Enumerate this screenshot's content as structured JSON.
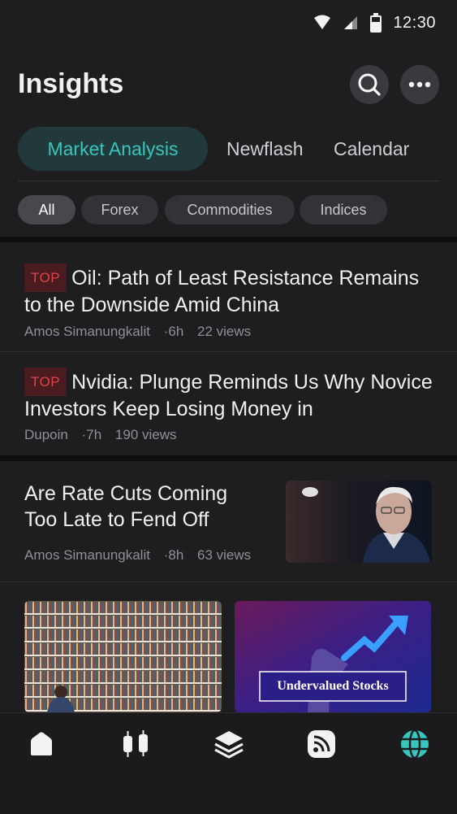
{
  "status_bar": {
    "time": "12:30"
  },
  "header": {
    "title": "Insights"
  },
  "tabs": [
    "Market Analysis",
    "Newflash",
    "Calendar"
  ],
  "filters": [
    "All",
    "Forex",
    "Commodities",
    "Indices"
  ],
  "articles": [
    {
      "tag": "TOP",
      "title": "Oil: Path of Least Resistance Remains to the Downside Amid China",
      "author": "Amos Simanungkalit",
      "time": "·6h",
      "views": "22 views"
    },
    {
      "tag": "TOP",
      "title": "Nvidia: Plunge Reminds Us Why Novice Investors Keep Losing Money in",
      "author": "Dupoin",
      "time": "·7h",
      "views": "190 views"
    },
    {
      "title": "Are Rate Cuts Coming Too Late to Fend Off",
      "author": "Amos Simanungkalit",
      "time": "·8h",
      "views": "63 views"
    }
  ],
  "cards": [
    {
      "image": "library-bookshelves-photo"
    },
    {
      "image": "undervalued-stocks-graphic",
      "caption": "Undervalued Stocks"
    }
  ],
  "bottom_nav": [
    {
      "icon": "home-icon"
    },
    {
      "icon": "candlestick-icon"
    },
    {
      "icon": "layers-icon"
    },
    {
      "icon": "feed-icon"
    },
    {
      "icon": "globe-icon",
      "active": true
    }
  ],
  "colors": {
    "accent": "#37c6bd",
    "tag_red": "#e0424a",
    "background": "#1e1e20"
  }
}
